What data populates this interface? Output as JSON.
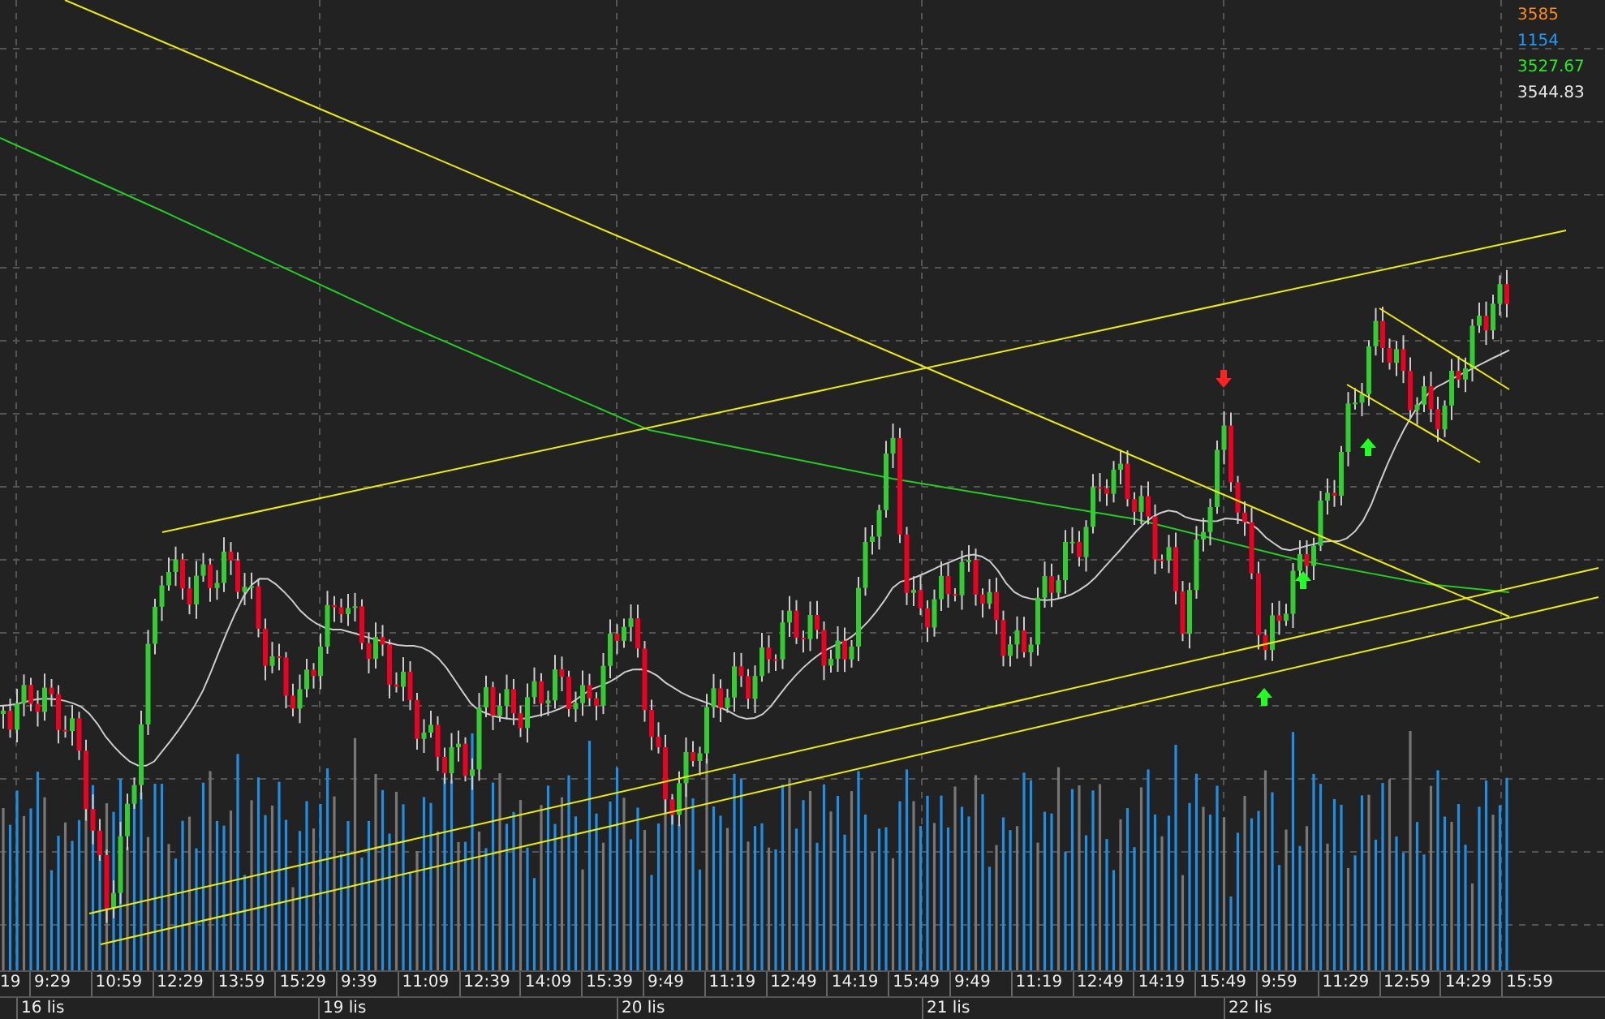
{
  "readings": [
    {
      "text": "3585",
      "color": "#ff8c1a"
    },
    {
      "text": "1154",
      "color": "#1e9bff"
    },
    {
      "text": "3527.67",
      "color": "#22ee22"
    },
    {
      "text": "3544.83",
      "color": "#e8e8e8"
    }
  ],
  "time_axis": {
    "times": [
      "19",
      "9:29",
      "10:59",
      "12:29",
      "13:59",
      "15:29",
      "9:39",
      "11:09",
      "12:39",
      "14:09",
      "15:39",
      "9:49",
      "11:19",
      "12:49",
      "14:19",
      "15:49",
      "9:49",
      "11:19",
      "12:49",
      "14:19",
      "15:49",
      "9:59",
      "11:29",
      "12:59",
      "14:29",
      "15:59"
    ],
    "dates": [
      "16 lis",
      "19 lis",
      "20 lis",
      "21 lis",
      "22 lis"
    ]
  }
}
